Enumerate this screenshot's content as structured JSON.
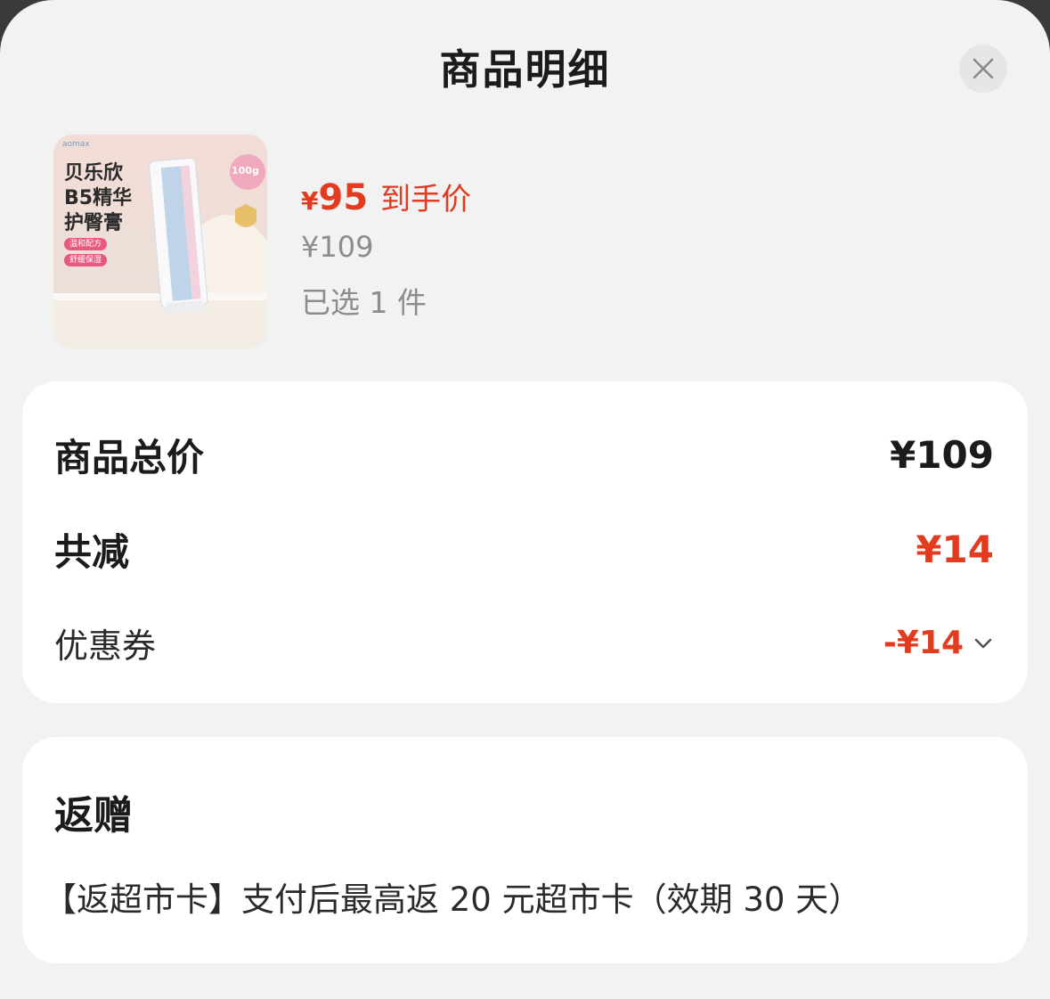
{
  "sheet": {
    "title": "商品明细",
    "close_icon": "close-icon"
  },
  "product": {
    "image_text": {
      "brand": "aomax",
      "name": "贝乐欣\nB5精华\n护臀膏",
      "chip_1": "温和配方",
      "chip_2": "舒缓保湿",
      "badge": "100g"
    },
    "price_symbol": "¥",
    "price": "95",
    "price_tag": "到手价",
    "original_price": "¥109",
    "selected": "已选 1 件"
  },
  "summary": {
    "total_label": "商品总价",
    "total_value": "¥109",
    "discount_label": "共减",
    "discount_value": "¥14",
    "coupon_label": "优惠券",
    "coupon_value": "-¥14",
    "coupon_icon": "chevron-down-icon"
  },
  "gift": {
    "title": "返赠",
    "description": "【返超市卡】支付后最高返 20 元超市卡（效期 30 天）"
  },
  "colors": {
    "accent_red": "#e33b1f",
    "sheet_bg": "#f2f2f2",
    "card_bg": "#ffffff"
  }
}
